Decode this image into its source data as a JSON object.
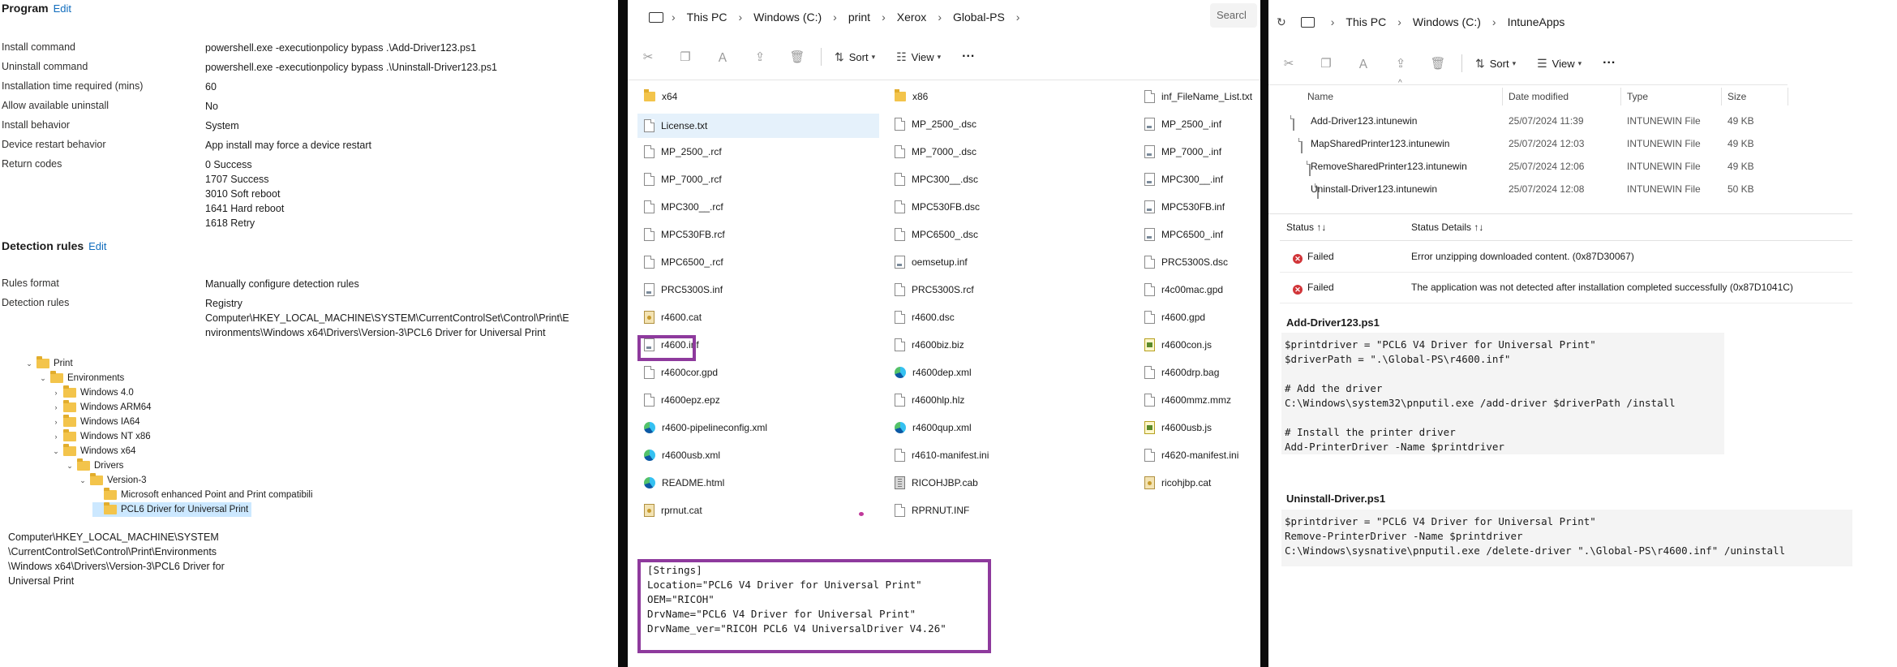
{
  "left": {
    "program_title": "Program",
    "edit_label": "Edit",
    "properties": [
      {
        "label": "Install command",
        "value": "powershell.exe -executionpolicy bypass .\\Add-Driver123.ps1"
      },
      {
        "label": "Uninstall command",
        "value": "powershell.exe -executionpolicy bypass .\\Uninstall-Driver123.ps1"
      },
      {
        "label": "Installation time required (mins)",
        "value": "60"
      },
      {
        "label": "Allow available uninstall",
        "value": "No"
      },
      {
        "label": "Install behavior",
        "value": "System"
      },
      {
        "label": "Device restart behavior",
        "value": "App install may force a device restart"
      },
      {
        "label": "Return codes",
        "value": "0 Success"
      }
    ],
    "return_codes_more": [
      "1707 Success",
      "3010 Soft reboot",
      "1641 Hard reboot",
      "1618 Retry"
    ],
    "detection_title": "Detection rules",
    "detection_edit": "Edit",
    "rules_format_label": "Rules format",
    "rules_format_value": "Manually configure detection rules",
    "detection_rules_label": "Detection rules",
    "detection_rules_value": [
      "Registry",
      "Computer\\HKEY_LOCAL_MACHINE\\SYSTEM\\CurrentControlSet\\Control\\Print\\E",
      "nvironments\\Windows x64\\Drivers\\Version-3\\PCL6 Driver for Universal Print"
    ],
    "tree": [
      {
        "label": "Print",
        "chev": "⌄"
      },
      {
        "label": "Environments",
        "chev": "⌄"
      },
      {
        "label": "Windows 4.0",
        "chev": "›"
      },
      {
        "label": "Windows ARM64",
        "chev": "›"
      },
      {
        "label": "Windows IA64",
        "chev": "›"
      },
      {
        "label": "Windows NT x86",
        "chev": "›"
      },
      {
        "label": "Windows x64",
        "chev": "⌄"
      },
      {
        "label": "Drivers",
        "chev": "⌄"
      },
      {
        "label": "Version-3",
        "chev": "⌄"
      },
      {
        "label": "Microsoft enhanced Point and Print compatibili",
        "chev": ""
      },
      {
        "label": "PCL6 Driver for Universal Print",
        "chev": ""
      }
    ],
    "registry_path": [
      "Computer\\HKEY_LOCAL_MACHINE\\SYSTEM",
      "\\CurrentControlSet\\Control\\Print\\Environments",
      "\\Windows x64\\Drivers\\Version-3\\PCL6 Driver for",
      "Universal Print"
    ]
  },
  "mid": {
    "breadcrumb": [
      "This PC",
      "Windows (C:)",
      "print",
      "Xerox",
      "Global-PS"
    ],
    "search_placeholder": "Searcl",
    "sort_label": "Sort",
    "view_label": "View",
    "more_label": "···",
    "col1": [
      {
        "name": "x64",
        "icon": "folder-ic"
      },
      {
        "name": "License.txt",
        "icon": "doc"
      },
      {
        "name": "MP_2500_.rcf",
        "icon": "doc"
      },
      {
        "name": "MP_7000_.rcf",
        "icon": "doc"
      },
      {
        "name": "MPC300__.rcf",
        "icon": "doc"
      },
      {
        "name": "MPC530FB.rcf",
        "icon": "doc"
      },
      {
        "name": "MPC6500_.rcf",
        "icon": "doc"
      },
      {
        "name": "PRC5300S.inf",
        "icon": "inf"
      },
      {
        "name": "r4600.cat",
        "icon": "cat"
      },
      {
        "name": "r4600.inf",
        "icon": "inf"
      },
      {
        "name": "r4600cor.gpd",
        "icon": "doc"
      },
      {
        "name": "r4600epz.epz",
        "icon": "doc"
      },
      {
        "name": "r4600-pipelineconfig.xml",
        "icon": "edge"
      },
      {
        "name": "r4600usb.xml",
        "icon": "edge"
      },
      {
        "name": "README.html",
        "icon": "edge"
      },
      {
        "name": "rprnut.cat",
        "icon": "cat"
      }
    ],
    "col2": [
      {
        "name": "x86",
        "icon": "folder-ic"
      },
      {
        "name": "MP_2500_.dsc",
        "icon": "doc"
      },
      {
        "name": "MP_7000_.dsc",
        "icon": "doc"
      },
      {
        "name": "MPC300__.dsc",
        "icon": "doc"
      },
      {
        "name": "MPC530FB.dsc",
        "icon": "doc"
      },
      {
        "name": "MPC6500_.dsc",
        "icon": "doc"
      },
      {
        "name": "oemsetup.inf",
        "icon": "inf"
      },
      {
        "name": "PRC5300S.rcf",
        "icon": "doc"
      },
      {
        "name": "r4600.dsc",
        "icon": "doc"
      },
      {
        "name": "r4600biz.biz",
        "icon": "doc"
      },
      {
        "name": "r4600dep.xml",
        "icon": "edge"
      },
      {
        "name": "r4600hlp.hlz",
        "icon": "doc"
      },
      {
        "name": "r4600qup.xml",
        "icon": "edge"
      },
      {
        "name": "r4610-manifest.ini",
        "icon": "doc"
      },
      {
        "name": "RICOHJBP.cab",
        "icon": "cab"
      },
      {
        "name": "RPRNUT.INF",
        "icon": "doc"
      }
    ],
    "col3": [
      {
        "name": "inf_FileName_List.txt",
        "icon": "doc"
      },
      {
        "name": "MP_2500_.inf",
        "icon": "inf"
      },
      {
        "name": "MP_7000_.inf",
        "icon": "inf"
      },
      {
        "name": "MPC300__.inf",
        "icon": "inf"
      },
      {
        "name": "MPC530FB.inf",
        "icon": "inf"
      },
      {
        "name": "MPC6500_.inf",
        "icon": "inf"
      },
      {
        "name": "PRC5300S.dsc",
        "icon": "doc"
      },
      {
        "name": "r4c00mac.gpd",
        "icon": "doc"
      },
      {
        "name": "r4600.gpd",
        "icon": "doc"
      },
      {
        "name": "r4600con.js",
        "icon": "js"
      },
      {
        "name": "r4600drp.bag",
        "icon": "doc"
      },
      {
        "name": "r4600mmz.mmz",
        "icon": "doc"
      },
      {
        "name": "r4600usb.js",
        "icon": "js"
      },
      {
        "name": "r4620-manifest.ini",
        "icon": "doc"
      },
      {
        "name": "ricohjbp.cat",
        "icon": "cat"
      }
    ],
    "inf_snippet": "[Strings]\nLocation=\"PCL6 V4 Driver for Universal Print\"\nOEM=\"RICOH\"\nDrvName=\"PCL6 V4 Driver for Universal Print\"\nDrvName_ver=\"RICOH PCL6 V4 UniversalDriver V4.26\""
  },
  "right": {
    "breadcrumb": [
      "This PC",
      "Windows (C:)",
      "IntuneApps"
    ],
    "sort_label": "Sort",
    "view_label": "View",
    "more_label": "···",
    "columns": [
      "Name",
      "Date modified",
      "Type",
      "Size"
    ],
    "files": [
      {
        "name": "Add-Driver123.intunewin",
        "date": "25/07/2024 11:39",
        "type": "INTUNEWIN File",
        "size": "49 KB"
      },
      {
        "name": "MapSharedPrinter123.intunewin",
        "date": "25/07/2024 12:03",
        "type": "INTUNEWIN File",
        "size": "49 KB"
      },
      {
        "name": "RemoveSharedPrinter123.intunewin",
        "date": "25/07/2024 12:06",
        "type": "INTUNEWIN File",
        "size": "49 KB"
      },
      {
        "name": "Uninstall-Driver123.intunewin",
        "date": "25/07/2024 12:08",
        "type": "INTUNEWIN File",
        "size": "50 KB"
      }
    ],
    "status_col": "Status ↑↓",
    "details_col": "Status Details ↑↓",
    "statuses": [
      {
        "status": "Failed",
        "details": "Error unzipping downloaded content. (0x87D30067)"
      },
      {
        "status": "Failed",
        "details": "The application was not detected after installation completed successfully (0x87D1041C)"
      }
    ],
    "add_title": "Add-Driver123.ps1",
    "add_code": "$printdriver = \"PCL6 V4 Driver for Universal Print\"\n$driverPath = \".\\Global-PS\\r4600.inf\"\n\n# Add the driver\nC:\\Windows\\system32\\pnputil.exe /add-driver $driverPath /install\n\n# Install the printer driver\nAdd-PrinterDriver -Name $printdriver",
    "uninstall_title": "Uninstall-Driver.ps1",
    "uninstall_code": "$printdriver = \"PCL6 V4 Driver for Universal Print\"\nRemove-PrinterDriver -Name $printdriver\nC:\\Windows\\sysnative\\pnputil.exe /delete-driver \".\\Global-PS\\r4600.inf\" /uninstall"
  },
  "colors": {
    "accent": "#0f6cbd",
    "highlight": "#8e3a9d",
    "selected": "#cce8ff",
    "error": "#d13438"
  }
}
